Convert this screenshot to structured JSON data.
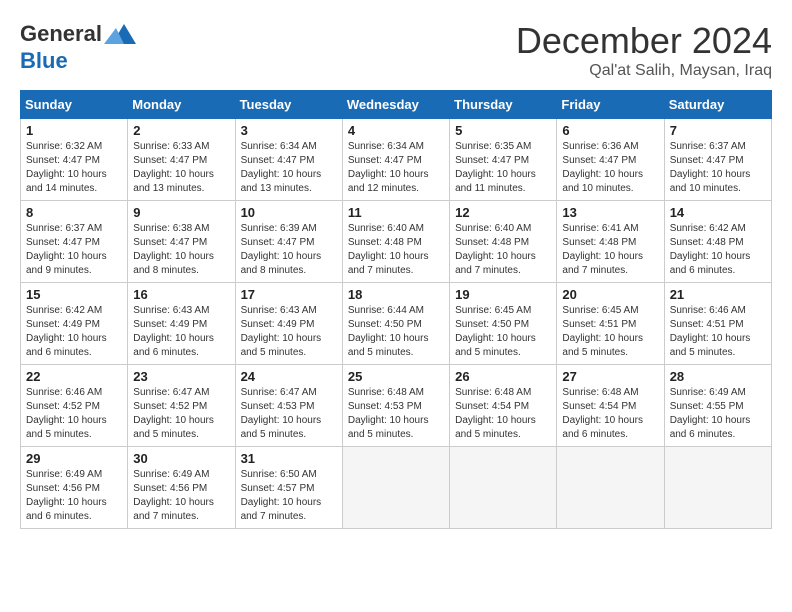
{
  "logo": {
    "general": "General",
    "blue": "Blue"
  },
  "title": "December 2024",
  "subtitle": "Qal'at Salih, Maysan, Iraq",
  "days_of_week": [
    "Sunday",
    "Monday",
    "Tuesday",
    "Wednesday",
    "Thursday",
    "Friday",
    "Saturday"
  ],
  "weeks": [
    [
      {
        "day": "1",
        "sunrise": "6:32 AM",
        "sunset": "4:47 PM",
        "daylight": "10 hours and 14 minutes."
      },
      {
        "day": "2",
        "sunrise": "6:33 AM",
        "sunset": "4:47 PM",
        "daylight": "10 hours and 13 minutes."
      },
      {
        "day": "3",
        "sunrise": "6:34 AM",
        "sunset": "4:47 PM",
        "daylight": "10 hours and 13 minutes."
      },
      {
        "day": "4",
        "sunrise": "6:34 AM",
        "sunset": "4:47 PM",
        "daylight": "10 hours and 12 minutes."
      },
      {
        "day": "5",
        "sunrise": "6:35 AM",
        "sunset": "4:47 PM",
        "daylight": "10 hours and 11 minutes."
      },
      {
        "day": "6",
        "sunrise": "6:36 AM",
        "sunset": "4:47 PM",
        "daylight": "10 hours and 10 minutes."
      },
      {
        "day": "7",
        "sunrise": "6:37 AM",
        "sunset": "4:47 PM",
        "daylight": "10 hours and 10 minutes."
      }
    ],
    [
      {
        "day": "8",
        "sunrise": "6:37 AM",
        "sunset": "4:47 PM",
        "daylight": "10 hours and 9 minutes."
      },
      {
        "day": "9",
        "sunrise": "6:38 AM",
        "sunset": "4:47 PM",
        "daylight": "10 hours and 8 minutes."
      },
      {
        "day": "10",
        "sunrise": "6:39 AM",
        "sunset": "4:47 PM",
        "daylight": "10 hours and 8 minutes."
      },
      {
        "day": "11",
        "sunrise": "6:40 AM",
        "sunset": "4:48 PM",
        "daylight": "10 hours and 7 minutes."
      },
      {
        "day": "12",
        "sunrise": "6:40 AM",
        "sunset": "4:48 PM",
        "daylight": "10 hours and 7 minutes."
      },
      {
        "day": "13",
        "sunrise": "6:41 AM",
        "sunset": "4:48 PM",
        "daylight": "10 hours and 7 minutes."
      },
      {
        "day": "14",
        "sunrise": "6:42 AM",
        "sunset": "4:48 PM",
        "daylight": "10 hours and 6 minutes."
      }
    ],
    [
      {
        "day": "15",
        "sunrise": "6:42 AM",
        "sunset": "4:49 PM",
        "daylight": "10 hours and 6 minutes."
      },
      {
        "day": "16",
        "sunrise": "6:43 AM",
        "sunset": "4:49 PM",
        "daylight": "10 hours and 6 minutes."
      },
      {
        "day": "17",
        "sunrise": "6:43 AM",
        "sunset": "4:49 PM",
        "daylight": "10 hours and 5 minutes."
      },
      {
        "day": "18",
        "sunrise": "6:44 AM",
        "sunset": "4:50 PM",
        "daylight": "10 hours and 5 minutes."
      },
      {
        "day": "19",
        "sunrise": "6:45 AM",
        "sunset": "4:50 PM",
        "daylight": "10 hours and 5 minutes."
      },
      {
        "day": "20",
        "sunrise": "6:45 AM",
        "sunset": "4:51 PM",
        "daylight": "10 hours and 5 minutes."
      },
      {
        "day": "21",
        "sunrise": "6:46 AM",
        "sunset": "4:51 PM",
        "daylight": "10 hours and 5 minutes."
      }
    ],
    [
      {
        "day": "22",
        "sunrise": "6:46 AM",
        "sunset": "4:52 PM",
        "daylight": "10 hours and 5 minutes."
      },
      {
        "day": "23",
        "sunrise": "6:47 AM",
        "sunset": "4:52 PM",
        "daylight": "10 hours and 5 minutes."
      },
      {
        "day": "24",
        "sunrise": "6:47 AM",
        "sunset": "4:53 PM",
        "daylight": "10 hours and 5 minutes."
      },
      {
        "day": "25",
        "sunrise": "6:48 AM",
        "sunset": "4:53 PM",
        "daylight": "10 hours and 5 minutes."
      },
      {
        "day": "26",
        "sunrise": "6:48 AM",
        "sunset": "4:54 PM",
        "daylight": "10 hours and 5 minutes."
      },
      {
        "day": "27",
        "sunrise": "6:48 AM",
        "sunset": "4:54 PM",
        "daylight": "10 hours and 6 minutes."
      },
      {
        "day": "28",
        "sunrise": "6:49 AM",
        "sunset": "4:55 PM",
        "daylight": "10 hours and 6 minutes."
      }
    ],
    [
      {
        "day": "29",
        "sunrise": "6:49 AM",
        "sunset": "4:56 PM",
        "daylight": "10 hours and 6 minutes."
      },
      {
        "day": "30",
        "sunrise": "6:49 AM",
        "sunset": "4:56 PM",
        "daylight": "10 hours and 7 minutes."
      },
      {
        "day": "31",
        "sunrise": "6:50 AM",
        "sunset": "4:57 PM",
        "daylight": "10 hours and 7 minutes."
      },
      null,
      null,
      null,
      null
    ]
  ],
  "labels": {
    "sunrise": "Sunrise:",
    "sunset": "Sunset:",
    "daylight": "Daylight:"
  }
}
